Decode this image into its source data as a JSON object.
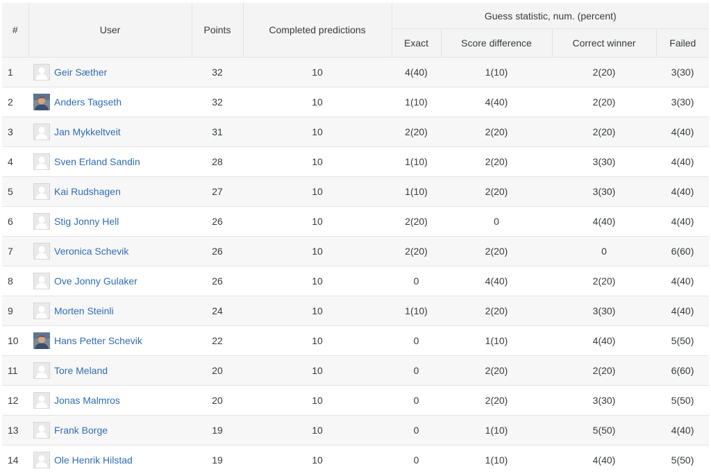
{
  "table": {
    "headers": {
      "rank": "#",
      "user": "User",
      "points": "Points",
      "completed": "Completed predictions",
      "guess_group": "Guess statistic, num. (percent)",
      "exact": "Exact",
      "score_diff": "Score difference",
      "correct_winner": "Correct winner",
      "failed": "Failed"
    },
    "rows": [
      {
        "rank": "1",
        "name": "Geir Sæther",
        "avatar": "default-avatar-icon",
        "points": "32",
        "completed": "10",
        "exact": "4(40)",
        "score_diff": "1(10)",
        "correct_winner": "2(20)",
        "failed": "3(30)"
      },
      {
        "rank": "2",
        "name": "Anders Tagseth",
        "avatar": "user-photo-icon",
        "points": "32",
        "completed": "10",
        "exact": "1(10)",
        "score_diff": "4(40)",
        "correct_winner": "2(20)",
        "failed": "3(30)"
      },
      {
        "rank": "3",
        "name": "Jan Mykkeltveit",
        "avatar": "default-avatar-icon",
        "points": "31",
        "completed": "10",
        "exact": "2(20)",
        "score_diff": "2(20)",
        "correct_winner": "2(20)",
        "failed": "4(40)"
      },
      {
        "rank": "4",
        "name": "Sven Erland Sandin",
        "avatar": "default-avatar-icon",
        "points": "28",
        "completed": "10",
        "exact": "1(10)",
        "score_diff": "2(20)",
        "correct_winner": "3(30)",
        "failed": "4(40)"
      },
      {
        "rank": "5",
        "name": "Kai Rudshagen",
        "avatar": "default-avatar-icon",
        "points": "27",
        "completed": "10",
        "exact": "1(10)",
        "score_diff": "2(20)",
        "correct_winner": "3(30)",
        "failed": "4(40)"
      },
      {
        "rank": "6",
        "name": "Stig Jonny Hell",
        "avatar": "default-avatar-icon",
        "points": "26",
        "completed": "10",
        "exact": "2(20)",
        "score_diff": "0",
        "correct_winner": "4(40)",
        "failed": "4(40)"
      },
      {
        "rank": "7",
        "name": "Veronica Schevik",
        "avatar": "default-avatar-icon",
        "points": "26",
        "completed": "10",
        "exact": "2(20)",
        "score_diff": "2(20)",
        "correct_winner": "0",
        "failed": "6(60)"
      },
      {
        "rank": "8",
        "name": "Ove Jonny Gulaker",
        "avatar": "default-avatar-icon",
        "points": "26",
        "completed": "10",
        "exact": "0",
        "score_diff": "4(40)",
        "correct_winner": "2(20)",
        "failed": "4(40)"
      },
      {
        "rank": "9",
        "name": "Morten Steinli",
        "avatar": "default-avatar-icon",
        "points": "24",
        "completed": "10",
        "exact": "1(10)",
        "score_diff": "2(20)",
        "correct_winner": "3(30)",
        "failed": "4(40)"
      },
      {
        "rank": "10",
        "name": "Hans Petter Schevik",
        "avatar": "user-photo-icon",
        "points": "22",
        "completed": "10",
        "exact": "0",
        "score_diff": "1(10)",
        "correct_winner": "4(40)",
        "failed": "5(50)"
      },
      {
        "rank": "11",
        "name": "Tore Meland",
        "avatar": "default-avatar-icon",
        "points": "20",
        "completed": "10",
        "exact": "0",
        "score_diff": "2(20)",
        "correct_winner": "2(20)",
        "failed": "6(60)"
      },
      {
        "rank": "12",
        "name": "Jonas Malmros",
        "avatar": "default-avatar-icon",
        "points": "20",
        "completed": "10",
        "exact": "0",
        "score_diff": "2(20)",
        "correct_winner": "3(30)",
        "failed": "5(50)"
      },
      {
        "rank": "13",
        "name": "Frank Borge",
        "avatar": "default-avatar-icon",
        "points": "19",
        "completed": "10",
        "exact": "0",
        "score_diff": "1(10)",
        "correct_winner": "5(50)",
        "failed": "4(40)"
      },
      {
        "rank": "14",
        "name": "Ole Henrik Hilstad",
        "avatar": "default-avatar-icon",
        "points": "19",
        "completed": "10",
        "exact": "0",
        "score_diff": "1(10)",
        "correct_winner": "4(40)",
        "failed": "5(50)"
      }
    ]
  },
  "colors": {
    "link": "#2f6db5",
    "header_bg": "#f4f4f4",
    "row_odd_bg": "#f7f7f7",
    "row_even_bg": "#ffffff",
    "text": "#373a3c"
  }
}
